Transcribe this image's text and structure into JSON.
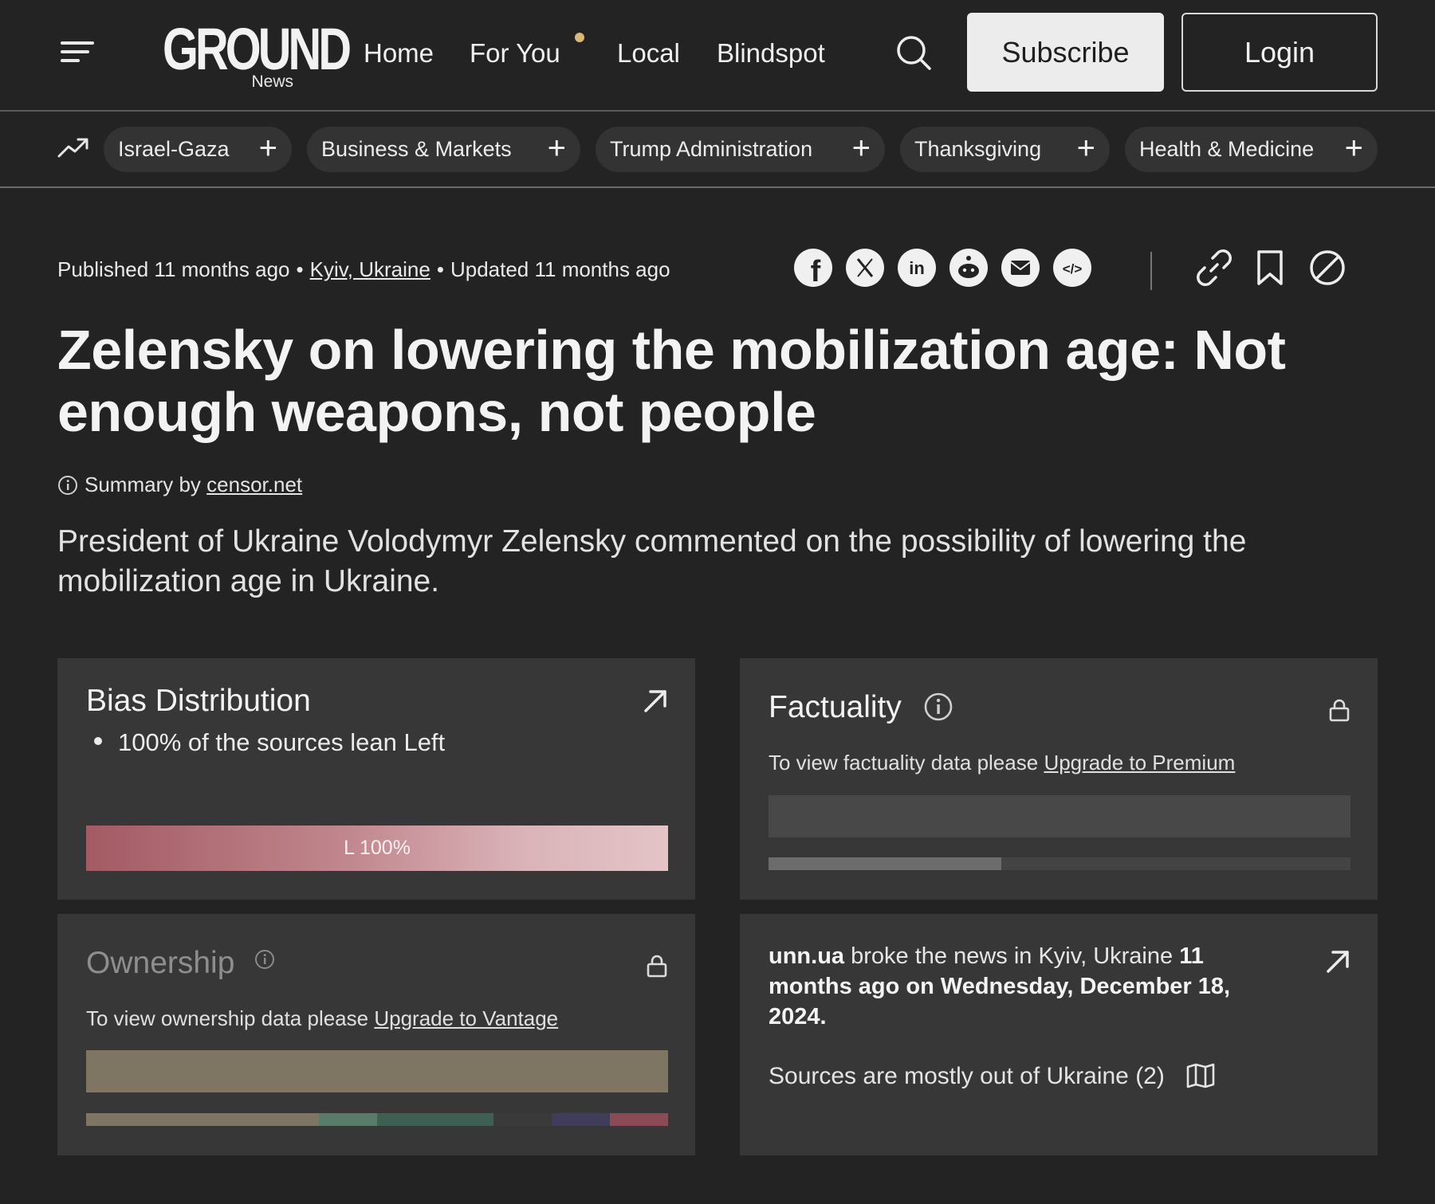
{
  "header": {
    "logo": "GROUND",
    "logo_sub": "News",
    "nav": [
      "Home",
      "For You",
      "Local",
      "Blindspot"
    ],
    "subscribe": "Subscribe",
    "login": "Login"
  },
  "topics": [
    {
      "label": "Israel-Gaza"
    },
    {
      "label": "Business & Markets"
    },
    {
      "label": "Trump Administration"
    },
    {
      "label": "Thanksgiving"
    },
    {
      "label": "Health & Medicine"
    }
  ],
  "topic_plus": "+",
  "article": {
    "published": "Published 11 months ago",
    "location": "Kyiv, Ukraine",
    "updated": "Updated 11 months ago",
    "meta_sep": "•",
    "title": "Zelensky on lowering the mobilization age: Not enough weapons, not people",
    "summary_by_prefix": "Summary by",
    "summary_source": "censor.net",
    "summary": "President of Ukraine Volodymyr Zelensky commented on the possibility of lowering the mobilization age in Ukraine."
  },
  "share_icons": [
    "facebook-icon",
    "x-icon",
    "linkedin-icon",
    "reddit-icon",
    "email-icon",
    "embed-icon"
  ],
  "bias": {
    "title": "Bias Distribution",
    "bullet": "100% of the sources lean Left",
    "bar_label": "L 100%",
    "left_percent": 100,
    "colors": {
      "left": "#a35a63",
      "light": "#e3c4c7"
    }
  },
  "factuality": {
    "title": "Factuality",
    "prefix": "To view factuality data please",
    "link": "Upgrade to Premium"
  },
  "ownership": {
    "title": "Ownership",
    "prefix": "To view ownership data please",
    "link": "Upgrade to Vantage"
  },
  "broke": {
    "source": "unn.ua",
    "middle": " broke the news in Kyiv, Ukraine ",
    "when": "11 months ago on Wednesday, December 18, 2024.",
    "sources_line": "Sources are mostly out of Ukraine (2)"
  }
}
